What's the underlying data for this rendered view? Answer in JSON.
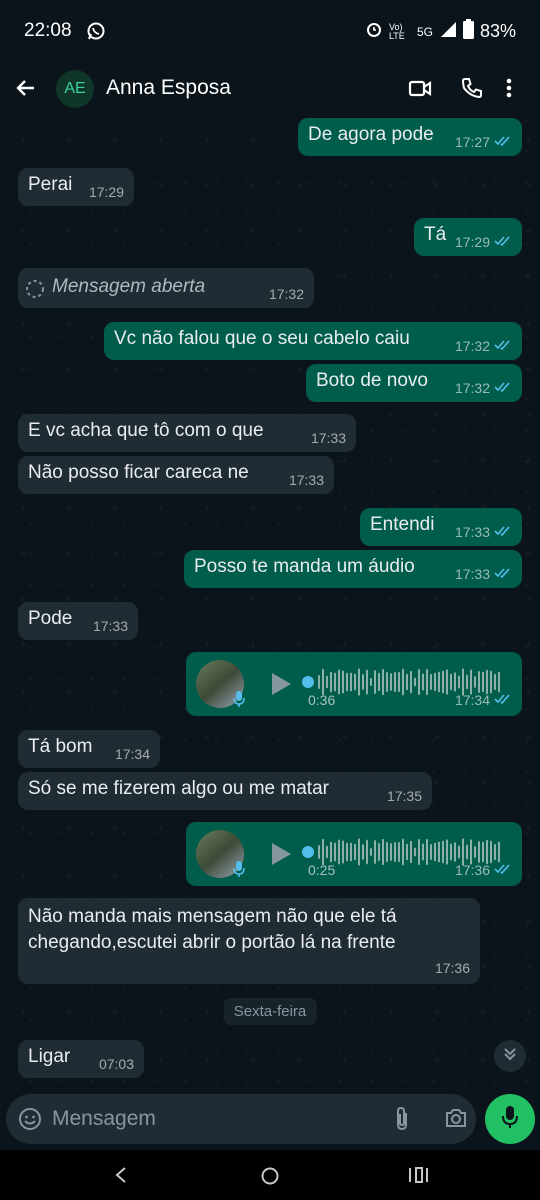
{
  "status_bar": {
    "time": "22:08",
    "network": "Vo) LTE",
    "signal_type": "5G",
    "battery": "83%"
  },
  "header": {
    "avatar_initials": "AE",
    "contact_name": "Anna Esposa"
  },
  "messages": [
    {
      "dir": "out",
      "text": "De agora pode",
      "time": "17:27"
    },
    {
      "dir": "in",
      "text": "Perai",
      "time": "17:29"
    },
    {
      "dir": "out",
      "text": "Tá",
      "time": "17:29"
    },
    {
      "dir": "in",
      "text": "Mensagem aberta",
      "time": "17:32"
    },
    {
      "dir": "out",
      "text": "Vc não falou que o seu cabelo caiu",
      "time": "17:32"
    },
    {
      "dir": "out",
      "text": "Boto de novo",
      "time": "17:32"
    },
    {
      "dir": "in",
      "text": "E vc acha que tô com o que",
      "time": "17:33"
    },
    {
      "dir": "in",
      "text": "Não posso ficar careca ne",
      "time": "17:33"
    },
    {
      "dir": "out",
      "text": "Entendi",
      "time": "17:33"
    },
    {
      "dir": "out",
      "text": "Posso te manda um áudio",
      "time": "17:33"
    },
    {
      "dir": "in",
      "text": "Pode",
      "time": "17:33"
    },
    {
      "dir": "out",
      "duration": "0:36",
      "time": "17:34"
    },
    {
      "dir": "in",
      "text": "Tá bom",
      "time": "17:34"
    },
    {
      "dir": "in",
      "text": "Só se me fizerem algo ou me matar",
      "time": "17:35"
    },
    {
      "dir": "out",
      "duration": "0:25",
      "time": "17:36"
    },
    {
      "dir": "in",
      "text_line1": "Não manda mais mensagem não que ele tá",
      "text_line2": "chegando,escutei abrir o portão lá na frente",
      "time": "17:36"
    },
    {
      "dir": "in",
      "text": "Ligar",
      "time": "07:03"
    }
  ],
  "day_separator": "Sexta-feira",
  "composer": {
    "placeholder": "Mensagem"
  },
  "colors": {
    "background": "#0b141a",
    "incoming": "#202c33",
    "outgoing": "#005c4b",
    "accent": "#21c063",
    "read_ticks": "#53bdeb"
  }
}
